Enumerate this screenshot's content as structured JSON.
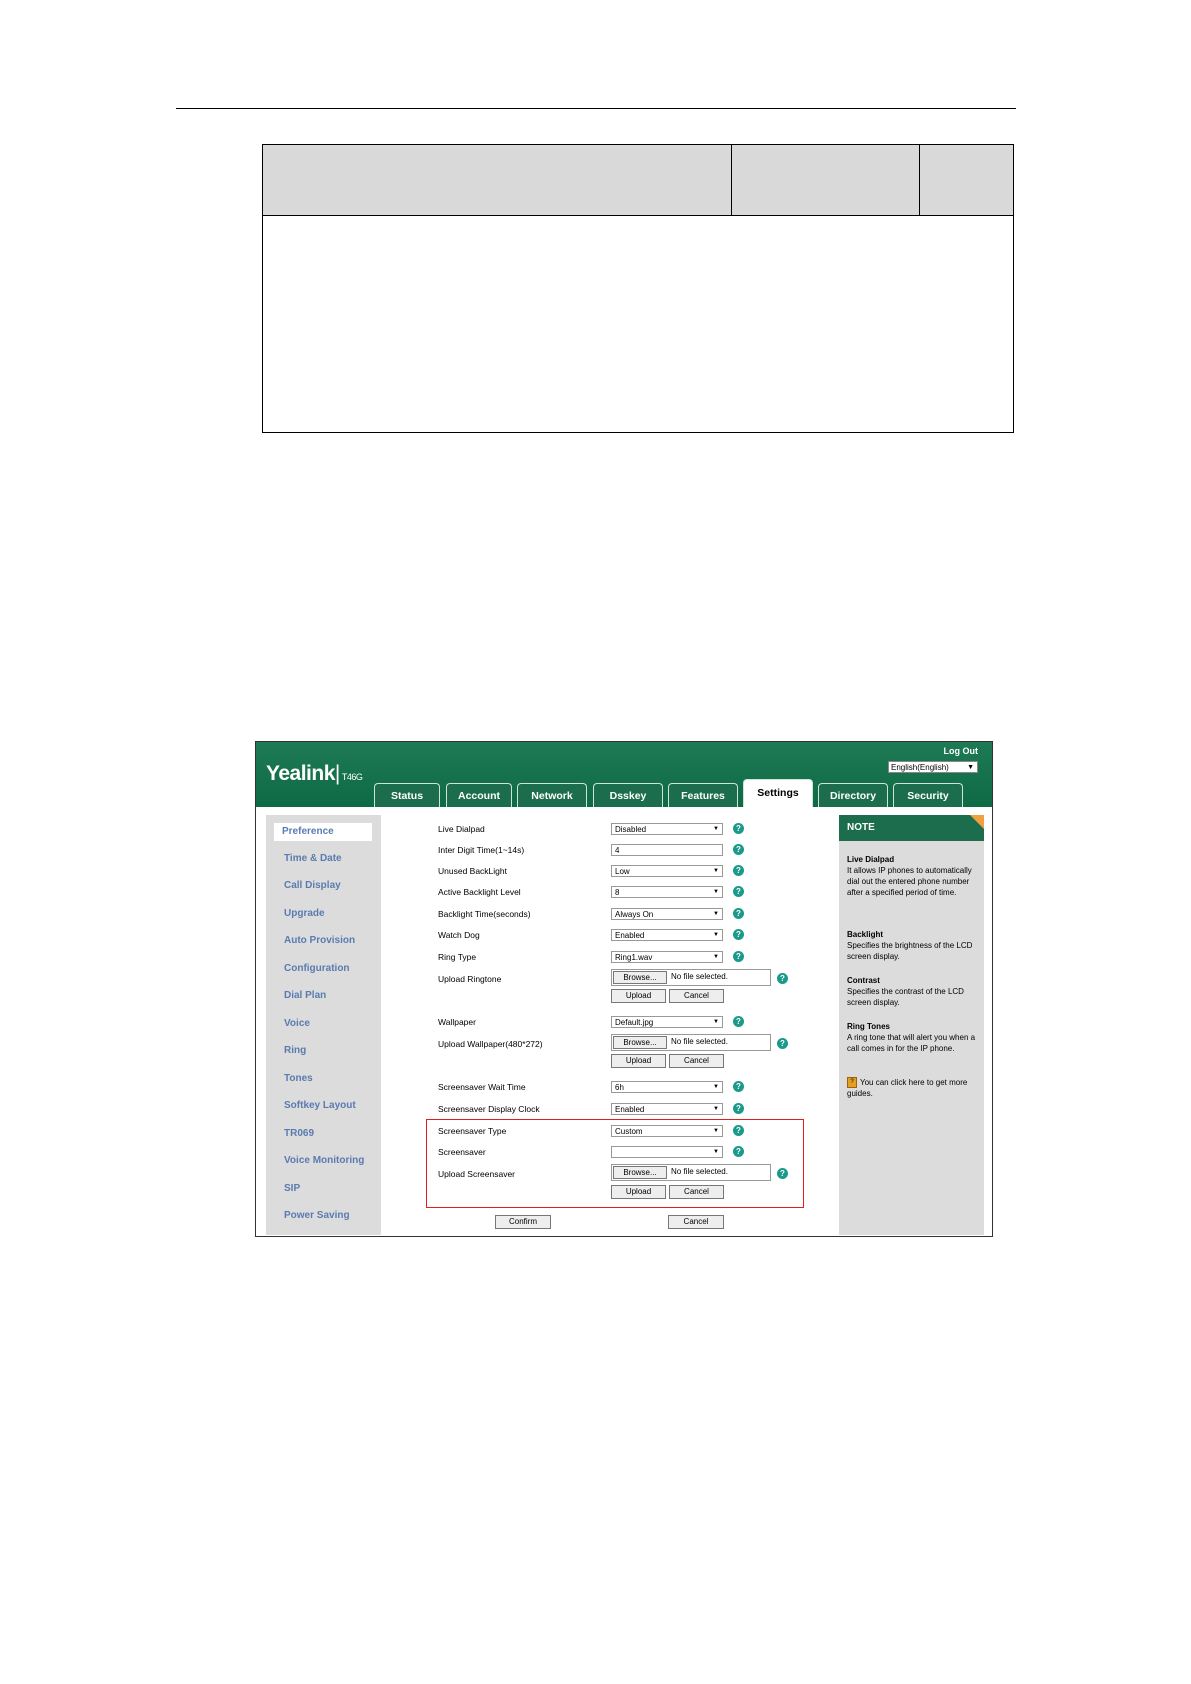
{
  "banner": {
    "logo_name": "Yealink",
    "logo_sep": "|",
    "logo_model": "T46G",
    "logout": "Log Out",
    "language": "English(English)"
  },
  "tabs": [
    {
      "label": "Status"
    },
    {
      "label": "Account"
    },
    {
      "label": "Network"
    },
    {
      "label": "Dsskey"
    },
    {
      "label": "Features"
    },
    {
      "label": "Settings"
    },
    {
      "label": "Directory"
    },
    {
      "label": "Security"
    }
  ],
  "sidebar": {
    "items": [
      {
        "label": "Preference"
      },
      {
        "label": "Time & Date"
      },
      {
        "label": "Call Display"
      },
      {
        "label": "Upgrade"
      },
      {
        "label": "Auto Provision"
      },
      {
        "label": "Configuration"
      },
      {
        "label": "Dial Plan"
      },
      {
        "label": "Voice"
      },
      {
        "label": "Ring"
      },
      {
        "label": "Tones"
      },
      {
        "label": "Softkey Layout"
      },
      {
        "label": "TR069"
      },
      {
        "label": "Voice Monitoring"
      },
      {
        "label": "SIP"
      },
      {
        "label": "Power Saving"
      }
    ]
  },
  "form": {
    "live_dialpad": {
      "label": "Live Dialpad",
      "value": "Disabled"
    },
    "inter_digit": {
      "label": "Inter Digit Time(1~14s)",
      "value": "4"
    },
    "unused_backlight": {
      "label": "Unused BackLight",
      "value": "Low"
    },
    "active_backlight": {
      "label": "Active Backlight Level",
      "value": "8"
    },
    "backlight_time": {
      "label": "Backlight Time(seconds)",
      "value": "Always On"
    },
    "watch_dog": {
      "label": "Watch Dog",
      "value": "Enabled"
    },
    "ring_type": {
      "label": "Ring Type",
      "value": "Ring1.wav"
    },
    "upload_ringtone": {
      "label": "Upload Ringtone"
    },
    "wallpaper": {
      "label": "Wallpaper",
      "value": "Default.jpg"
    },
    "upload_wallpaper": {
      "label": "Upload Wallpaper(480*272)"
    },
    "screensaver_wait": {
      "label": "Screensaver Wait Time",
      "value": "6h"
    },
    "screensaver_clock": {
      "label": "Screensaver Display Clock",
      "value": "Enabled"
    },
    "screensaver_type": {
      "label": "Screensaver Type",
      "value": "Custom"
    },
    "screensaver": {
      "label": "Screensaver",
      "value": ""
    },
    "upload_screensaver": {
      "label": "Upload Screensaver"
    }
  },
  "buttons": {
    "browse": "Browse...",
    "no_file": "No file selected.",
    "upload": "Upload",
    "cancel": "Cancel",
    "confirm": "Confirm",
    "help": "?"
  },
  "note": {
    "title": "NOTE",
    "live_dialpad_title": "Live Dialpad",
    "live_dialpad_text": "It allows IP phones to automatically dial out the entered phone number after a specified period of time.",
    "backlight_title": "Backlight",
    "backlight_text": "Specifies the brightness of the LCD screen display.",
    "contrast_title": "Contrast",
    "contrast_text": "Specifies the contrast of the LCD screen display.",
    "ringtones_title": "Ring Tones",
    "ringtones_text": "A ring tone that will alert you when a call comes in for the IP phone.",
    "guide_icon": "?",
    "guide_text": "You can click here to get more guides."
  },
  "colors": {
    "banner": "#0e6a45",
    "sidebar_link": "#5a7bb0",
    "highlight_box": "#e02020",
    "help_icon": "#1a9a8a"
  }
}
